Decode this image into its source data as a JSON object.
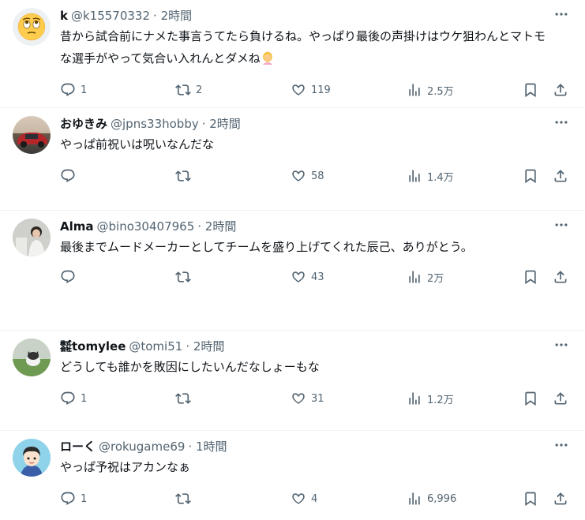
{
  "tweets": [
    {
      "name": "k",
      "handle": "@k15570332",
      "time": "· 2時間",
      "text": "昔から試合前にナメた事言うてたら負けるね。やっぱり最後の声掛けはウケ狙わんとマトモな選手がやって気合い入れんとダメね",
      "emoji": "woman-facepalming-emoji",
      "avatar": "rolling-eyes-face-avatar",
      "replies": "1",
      "retweets": "2",
      "likes": "119",
      "views": "2.5万"
    },
    {
      "name": "おゆきみ",
      "handle": "@jpns33hobby",
      "time": "· 2時間",
      "text": "やっぱ前祝いは呪いなんだな",
      "avatar": "red-car-photo-avatar",
      "replies": "",
      "retweets": "",
      "likes": "58",
      "views": "1.4万"
    },
    {
      "name": "Alma",
      "handle": "@bino30407965",
      "time": "· 2時間",
      "text": "最後までムードメーカーとしてチームを盛り上げてくれた辰己、ありがとう。",
      "avatar": "person-photo-avatar",
      "replies": "",
      "retweets": "",
      "likes": "43",
      "views": "2万"
    },
    {
      "name": "㍿tomylee",
      "handle": "@tomi51",
      "time": "· 2時間",
      "text": "どうしても誰かを敗因にしたいんだなしょーもな",
      "avatar": "cat-in-grass-photo-avatar",
      "replies": "1",
      "retweets": "",
      "likes": "31",
      "views": "1.2万"
    },
    {
      "name": "ローく",
      "handle": "@rokugame69",
      "time": "· 1時間",
      "text": "やっぱ予祝はアカンなぁ",
      "avatar": "cartoon-boy-avatar",
      "replies": "1",
      "retweets": "",
      "likes": "4",
      "views": "6,996"
    }
  ]
}
